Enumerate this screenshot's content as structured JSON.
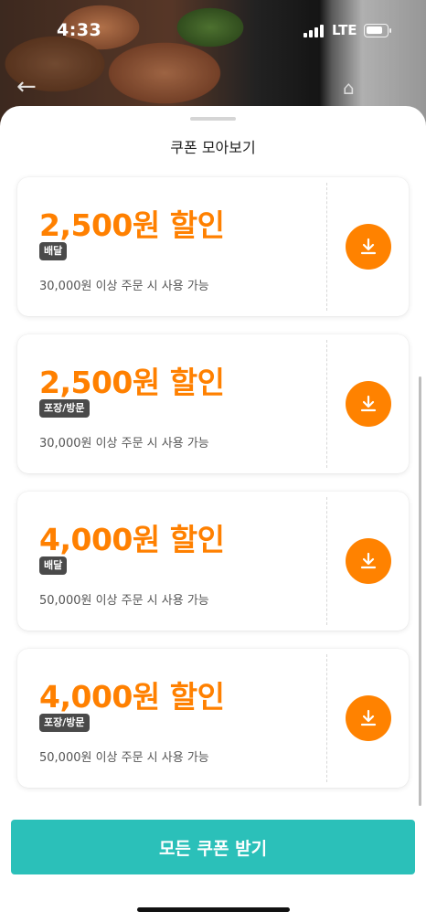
{
  "status_bar": {
    "time": "4:33",
    "network": "LTE"
  },
  "sheet": {
    "title": "쿠폰 모아보기"
  },
  "coupons": [
    {
      "amount": "2,500원 할인",
      "tag": "배달",
      "condition": "30,000원 이상 주문 시 사용 가능"
    },
    {
      "amount": "2,500원 할인",
      "tag": "포장/방문",
      "condition": "30,000원 이상 주문 시 사용 가능"
    },
    {
      "amount": "4,000원 할인",
      "tag": "배달",
      "condition": "50,000원 이상 주문 시 사용 가능"
    },
    {
      "amount": "4,000원 할인",
      "tag": "포장/방문",
      "condition": "50,000원 이상 주문 시 사용 가능"
    }
  ],
  "footer": {
    "receive_all_label": "모든 쿠폰 받기"
  },
  "colors": {
    "accent_orange": "#ff8200",
    "teal_button": "#2bc0b9",
    "tag_bg": "#4a4a4a"
  },
  "icons": {
    "download": "download-icon",
    "back": "back-arrow-icon"
  }
}
